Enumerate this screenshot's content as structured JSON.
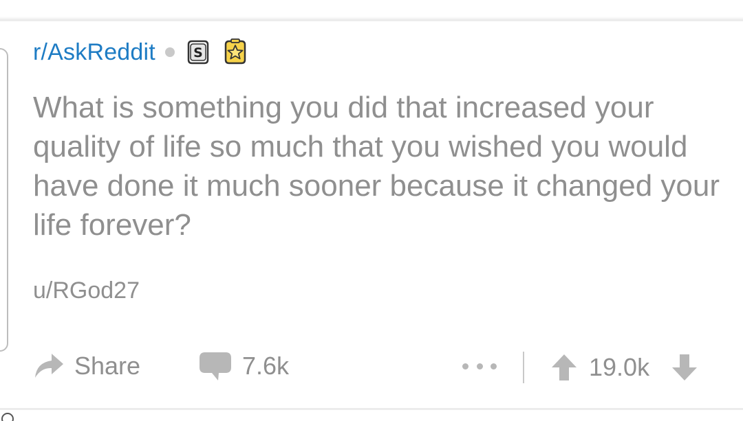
{
  "post": {
    "subreddit": "r/AskReddit",
    "title": "What is something you did that increased your quality of life so much that you wished you would have done it much sooner because it changed your life forever?",
    "author": "u/RGod27",
    "awards": [
      "silver-award-icon",
      "gold-award-icon"
    ]
  },
  "actions": {
    "share_label": "Share",
    "comments_count": "7.6k",
    "score": "19.0k"
  },
  "colors": {
    "subreddit": "#1e7cc4",
    "muted_text": "#8f8f8f",
    "icon_gray": "#b7b7b7",
    "gold": "#f0c419"
  }
}
